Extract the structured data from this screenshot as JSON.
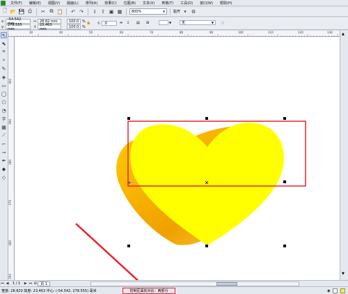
{
  "menubar": {
    "items": [
      "文件(F)",
      "编辑(E)",
      "视图(V)",
      "版面(L)",
      "排列(A)",
      "效果(C)",
      "位图(B)",
      "文本(X)",
      "表格(T)",
      "工具(O)",
      "窗口(W)",
      "帮助(H)"
    ]
  },
  "toolbar": {
    "zoom_value": "800%",
    "snap_label": "贴齐"
  },
  "propbar": {
    "x_label": "x:",
    "x_value": "-54.542 mm",
    "y_label": "y:",
    "y_value": "278.555 mm",
    "w_value": "28.82 mm",
    "h_value": "23.463 mm",
    "scale_x": "100.0",
    "scale_y": "100.0",
    "pct": "%",
    "rotation": ".0",
    "outline_value": "无"
  },
  "rulers": {
    "top_ticks": [
      "30",
      "40",
      "50",
      "60",
      "70",
      "80",
      "90",
      "100",
      "110",
      "120",
      "130"
    ],
    "left_ticks": [
      "300",
      "290",
      "280",
      "270",
      "260",
      "250"
    ]
  },
  "navbar": {
    "page_count": "1 / 1",
    "page_tab": "页 1"
  },
  "statusbar": {
    "dimensions_text": "宽度: 28.820  高度: 23.463  中心: (-54.542, 278.555)  毫米",
    "hint_text": "控制区属的对比：两部分"
  },
  "colors": {
    "heart_fill": "#ffff00",
    "heart_side": "#f0a800",
    "annotation_red": "#e8232a",
    "fill_swatch": "#ffff00",
    "outline_swatch": "#ffffff"
  },
  "icons": {
    "new": "new-document-icon",
    "open": "open-folder-icon",
    "save": "save-icon",
    "undo": "undo-icon",
    "redo": "redo-icon"
  }
}
